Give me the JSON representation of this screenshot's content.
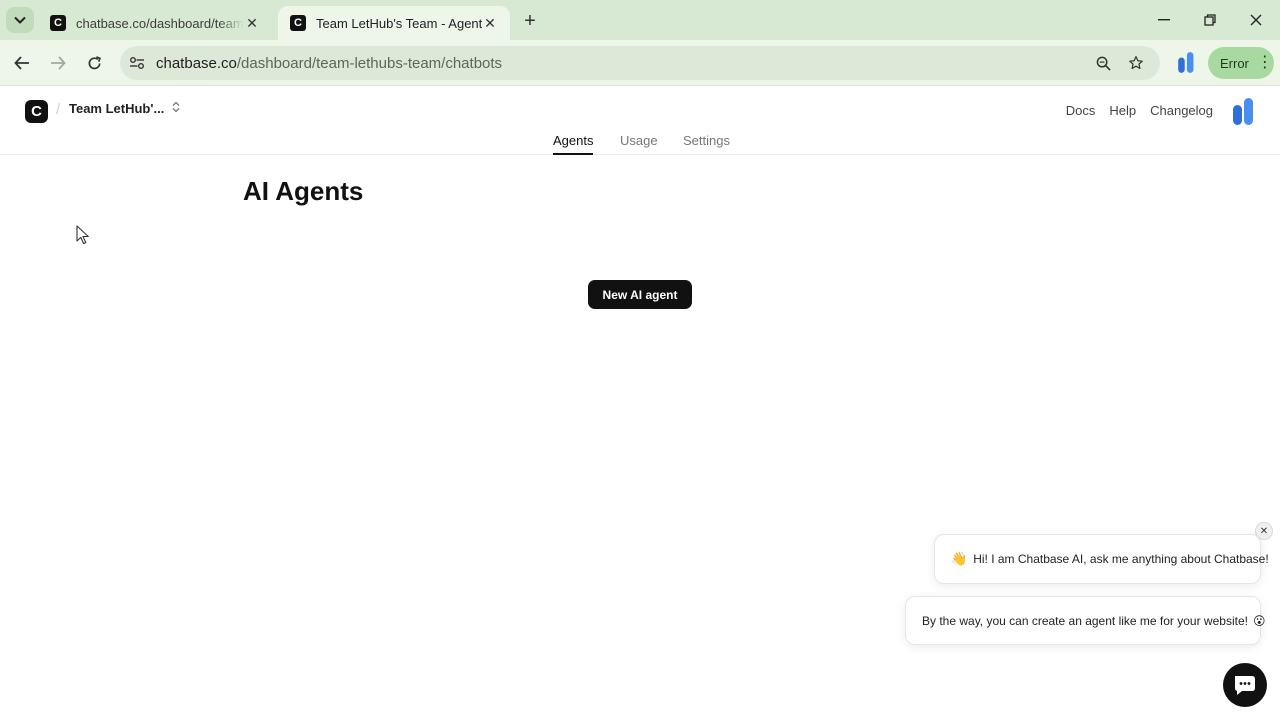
{
  "browser": {
    "tabs": [
      {
        "title": "chatbase.co/dashboard/team-lethubs-team/chatbots",
        "favicon": "C",
        "active": false
      },
      {
        "title": "Team LetHub's Team - Agents",
        "favicon": "C",
        "active": true
      }
    ],
    "url_host": "chatbase.co",
    "url_path": "/dashboard/team-lethubs-team/chatbots",
    "profile_status": "Error"
  },
  "header": {
    "logo_letter": "C",
    "separator": "/",
    "team_name": "Team LetHub'...",
    "links": [
      "Docs",
      "Help",
      "Changelog"
    ]
  },
  "subnav": {
    "tabs": [
      {
        "label": "Agents",
        "active": true
      },
      {
        "label": "Usage",
        "active": false
      },
      {
        "label": "Settings",
        "active": false
      }
    ]
  },
  "main": {
    "title": "AI Agents",
    "new_agent_label": "New AI agent"
  },
  "chat_widget": {
    "greeting": "Hi! I am Chatbase AI, ask me anything about Chatbase!",
    "greeting_emoji": "👋",
    "promo": "By the way, you can create an agent like me for your website!",
    "promo_emoji": "😮",
    "close_glyph": "✕"
  },
  "colors": {
    "tabbar_bg": "#d7e9d2",
    "toolbar_bg": "#eef6ea",
    "error_pill": "#a8d9a0",
    "primary_button": "#111111",
    "extension_blue": "#3b7ee8"
  }
}
